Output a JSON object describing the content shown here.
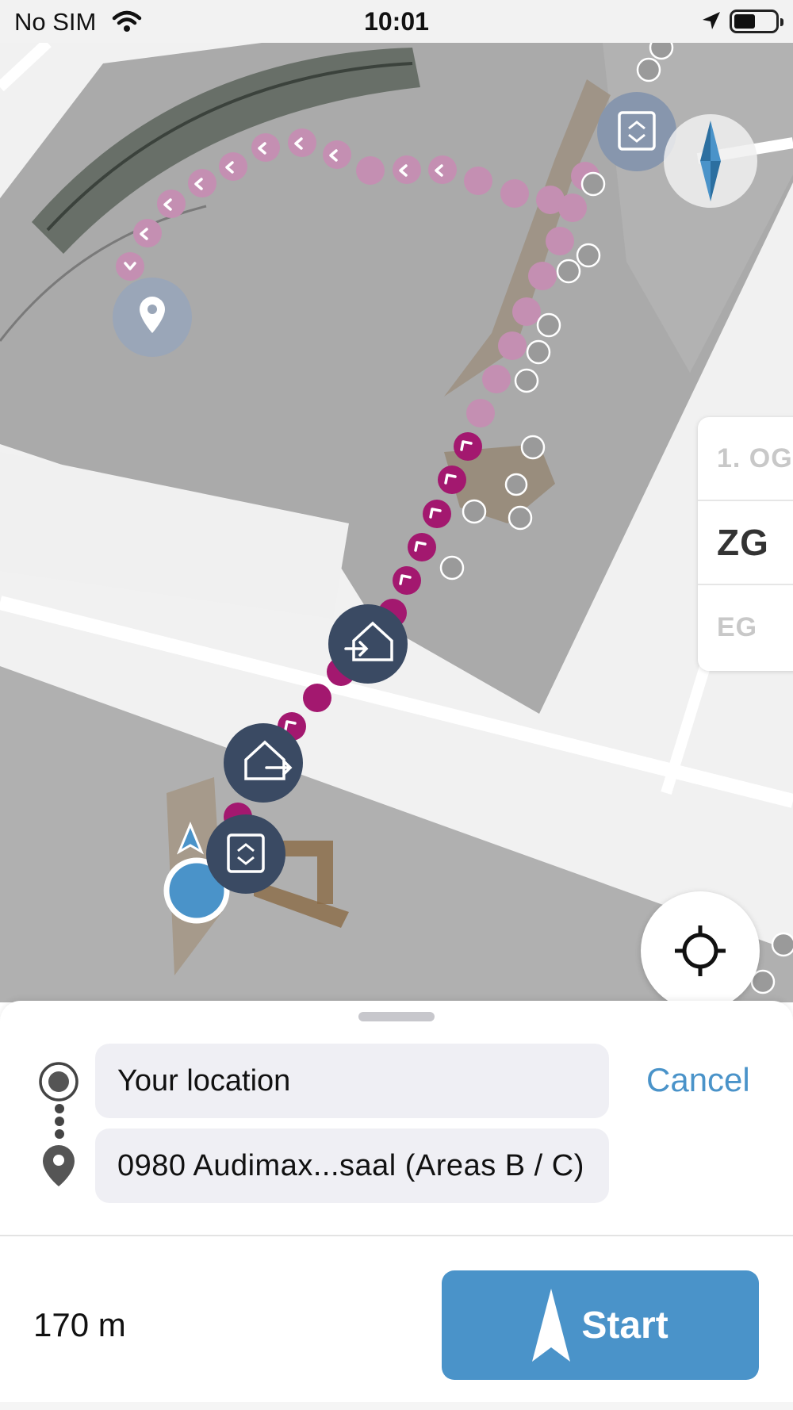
{
  "status_bar": {
    "carrier": "No SIM",
    "time": "10:01",
    "icons": [
      "wifi-icon",
      "location-arrow-icon",
      "battery-icon"
    ]
  },
  "map": {
    "floors": [
      {
        "label": "1. OG",
        "active": false
      },
      {
        "label": "ZG",
        "active": true
      },
      {
        "label": "EG",
        "active": false
      }
    ],
    "route_color": "#a3186f",
    "route_color_dimmed": "#c48fb2",
    "marker_color": "#3a4a63",
    "user_location_color": "#4a93c9",
    "icons": [
      "compass-icon",
      "destination-pin-icon",
      "elevator-icon",
      "building-enter-icon",
      "building-exit-icon",
      "user-location-icon",
      "locate-me-icon"
    ]
  },
  "route_sheet": {
    "origin": "Your location",
    "destination": "0980 Audimax...saal (Areas B / C)",
    "cancel_label": "Cancel",
    "distance": "170 m",
    "start_label": "Start"
  },
  "colors": {
    "accent": "#4a93c9",
    "route": "#a3186f"
  }
}
